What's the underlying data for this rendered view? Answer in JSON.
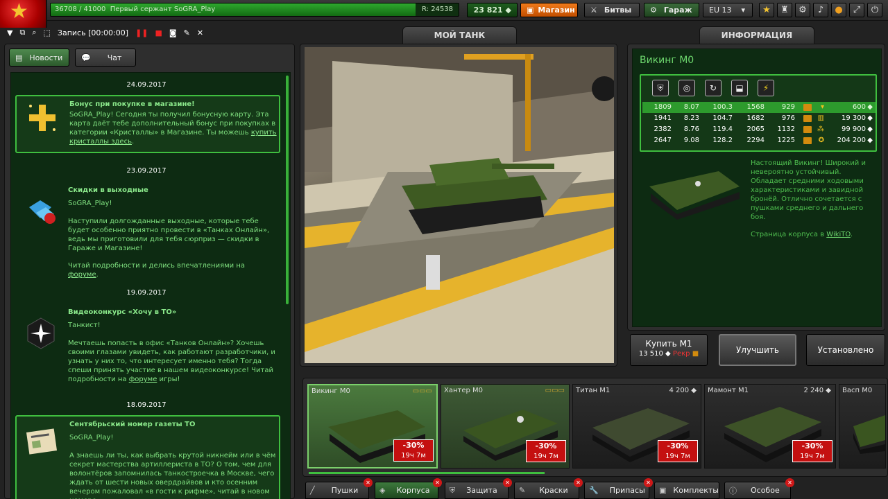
{
  "topbar": {
    "progress_text": "36708 / 41000",
    "rank_name": "Первый сержант SoGRA_Play",
    "rating": "R: 24538",
    "rank_progress_fraction": 0.895,
    "crystals": "23 821",
    "shop_label": "Магазин",
    "battles_label": "Битвы",
    "garage_label": "Гараж",
    "server_label": "EU 13"
  },
  "recording": {
    "label": "Запись [00:00:00]"
  },
  "tabs": {
    "my_tank": "МОЙ ТАНК",
    "info": "ИНФОРМАЦИЯ"
  },
  "news_panel": {
    "news_label": "Новости",
    "chat_label": "Чат",
    "entries": [
      {
        "date": "24.09.2017",
        "title": "Бонус при покупке в магазине!",
        "body": "SoGRA_Play! Сегодня ты получил бонусную карту. Эта карта даёт тебе дополнительный бонус при покупках в категории «Кристаллы» в Магазине. Ты можешь ",
        "link": "купить кристаллы здесь",
        "tail": "."
      },
      {
        "date": "23.09.2017",
        "title": "Скидки в выходные",
        "sub": "SoGRA_Play!",
        "body": "Наступили долгожданные выходные, которые тебе будет особенно приятно провести в «Танках Онлайн», ведь мы приготовили для тебя сюрприз — скидки в Гараже и Магазине!",
        "body2": "Читай подробности и делись впечатлениями на ",
        "link": "форуме",
        "tail": "."
      },
      {
        "date": "19.09.2017",
        "title": "Видеоконкурс «Хочу в ТО»",
        "sub": "Танкист!",
        "body": "Мечтаешь попасть в офис «Танков Онлайн»? Хочешь своими глазами увидеть, как работают разработчики, и узнать у них то, что интересует именно тебя? Тогда спеши принять участие в нашем видеоконкурсе! Читай подробности на ",
        "link": "форуме",
        "tail": " игры!"
      },
      {
        "date": "18.09.2017",
        "title": "Сентябрьский номер газеты ТО",
        "sub": "SoGRA_Play!",
        "body": "А знаешь ли ты, как выбрать крутой никнейм или в чём секрет мастерства артиллериста в ТО? О том, чем для волонтёров запомнилась танкостроечка в Москве, чего ждать от шести новых овердрайвов и кто осенним вечером пожаловал «в гости к рифме», читай в новом номере"
      }
    ]
  },
  "info_panel": {
    "name": "Викинг М0",
    "stat_icons": [
      "armor-icon",
      "speed-icon",
      "turn-icon",
      "weight-icon",
      "power-icon"
    ],
    "rows": [
      {
        "v": [
          "1809",
          "8.07",
          "100.3",
          "1568",
          "929"
        ],
        "price": "600",
        "active": true,
        "rank": "chevron"
      },
      {
        "v": [
          "1941",
          "8.23",
          "104.7",
          "1682",
          "976"
        ],
        "price": "19 300",
        "active": false,
        "rank": "bar"
      },
      {
        "v": [
          "2382",
          "8.76",
          "119.4",
          "2065",
          "1132"
        ],
        "price": "99 900",
        "active": false,
        "rank": "stars"
      },
      {
        "v": [
          "2647",
          "9.08",
          "128.2",
          "2294",
          "1225"
        ],
        "price": "204 200",
        "active": false,
        "rank": "emblem"
      }
    ],
    "description": "Настоящий Викинг! Широкий и невероятно устойчивый. Обладает средними ходовыми характеристиками и завидной бронёй. Отлично сочетается с пушками среднего и дальнего боя.",
    "wiki_prefix": "Страница корпуса в ",
    "wiki_link": "WikiTO",
    "wiki_suffix": "."
  },
  "actions": {
    "buy_label": "Купить М1",
    "buy_price": "13 510",
    "buy_rank": "Рекр",
    "upgrade_label": "Улучшить",
    "installed_label": "Установлено"
  },
  "carousel": [
    {
      "name": "Викинг М0",
      "price": "",
      "discount": "-30%",
      "time": "19ч 7м",
      "selected": true
    },
    {
      "name": "Хантер М0",
      "price": "",
      "discount": "-30%",
      "time": "19ч 7м",
      "selected": false
    },
    {
      "name": "Титан М1",
      "price": "4 200",
      "discount": "-30%",
      "time": "19ч 7м",
      "selected": false
    },
    {
      "name": "Мамонт М1",
      "price": "2 240",
      "discount": "-30%",
      "time": "19ч 7м",
      "selected": false
    },
    {
      "name": "Васп М0",
      "price": "",
      "discount": "",
      "time": "",
      "selected": false
    }
  ],
  "filters": [
    "Пушки",
    "Корпуса",
    "Защита",
    "Краски",
    "Припасы",
    "Комплекты",
    "Особое"
  ],
  "colors": {
    "accent_green": "#3fbf3f",
    "shop_orange": "#e06a10",
    "sale_red": "#c41010"
  }
}
